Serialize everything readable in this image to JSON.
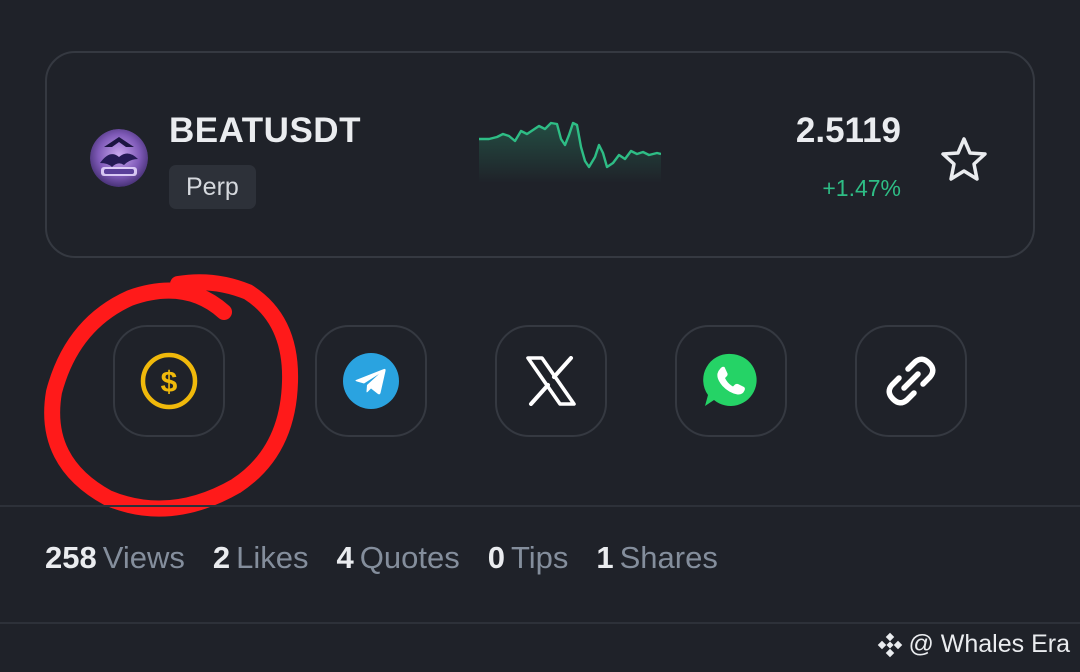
{
  "ticker": {
    "symbol": "BEATUSDT",
    "contract_type": "Perp",
    "price": "2.5119",
    "change_percent": "+1.47%",
    "change_color": "#2ebd85",
    "avatar_icon": "whales-era-logo",
    "favorite_icon": "star-outline-icon",
    "sparkline_icon": "price-sparkline"
  },
  "actions": [
    {
      "icon": "dollar-coin-icon",
      "color": "#f0b90b"
    },
    {
      "icon": "telegram-icon",
      "color": "#2aa3e0"
    },
    {
      "icon": "x-icon",
      "color": "#ffffff"
    },
    {
      "icon": "whatsapp-icon",
      "color": "#25d366"
    },
    {
      "icon": "link-icon",
      "color": "#ffffff"
    }
  ],
  "annotation": {
    "color": "#ff1a1a",
    "target": "tip-button"
  },
  "stats": [
    {
      "value": "258",
      "label": "Views"
    },
    {
      "value": "2",
      "label": "Likes"
    },
    {
      "value": "4",
      "label": "Quotes"
    },
    {
      "value": "0",
      "label": "Tips"
    },
    {
      "value": "1",
      "label": "Shares"
    }
  ],
  "watermark": {
    "text": "@ Whales Era",
    "icon": "binance-logo-icon"
  }
}
